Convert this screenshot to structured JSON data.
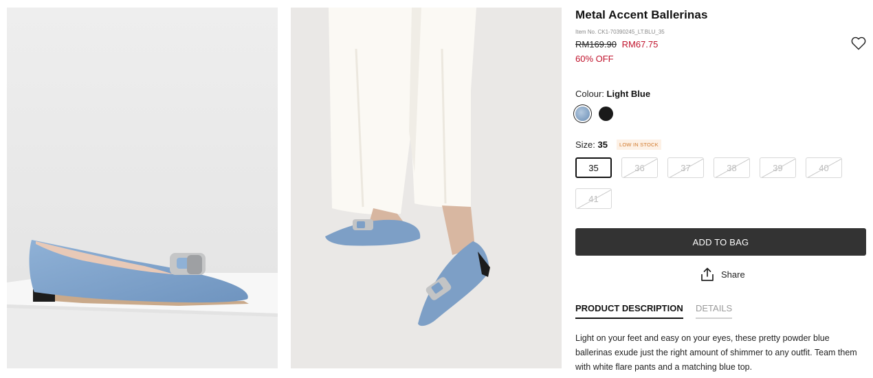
{
  "product": {
    "title": "Metal Accent Ballerinas",
    "item_no": "Item No. CK1-70390245_LT.BLU_35",
    "original_price": "RM169.90",
    "sale_price": "RM67.75",
    "discount": "60% OFF"
  },
  "colour": {
    "label": "Colour:",
    "selected": "Light Blue",
    "options": [
      {
        "name": "Light Blue",
        "color": "#7f9fc2"
      },
      {
        "name": "Black",
        "color": "#1a1a1a"
      }
    ]
  },
  "size": {
    "label": "Size:",
    "selected": "35",
    "stock_badge": "LOW IN STOCK",
    "options": [
      "35",
      "36",
      "37",
      "38",
      "39",
      "40",
      "41"
    ]
  },
  "actions": {
    "add_to_bag": "ADD TO BAG",
    "share": "Share"
  },
  "tabs": {
    "description": "PRODUCT DESCRIPTION",
    "details": "DETAILS"
  },
  "description": "Light on your feet and easy on your eyes, these pretty powder blue ballerinas exude just the right amount of shimmer to any outfit. Team them with white flare pants and a matching blue top.",
  "colors": {
    "accent_red": "#c0122b",
    "button_dark": "#333333",
    "badge_orange": "#d0782a"
  },
  "icons": [
    "heart-icon",
    "share-icon"
  ]
}
